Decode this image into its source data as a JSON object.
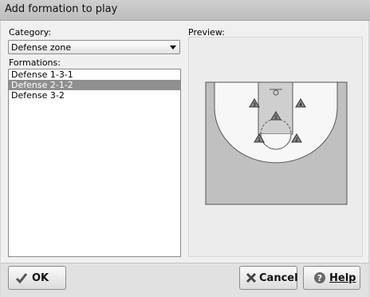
{
  "window": {
    "title": "Add formation to play"
  },
  "category": {
    "label": "Category:",
    "selected": "Defense zone"
  },
  "formations": {
    "label": "Formations:",
    "items": [
      "Defense 1-3-1",
      "Defense 2-1-2",
      "Defense 3-2"
    ],
    "selected_index": 1
  },
  "preview": {
    "label": "Preview:",
    "players": [
      "1",
      "2",
      "3",
      "4",
      "5"
    ],
    "court_color": "#c0c0c0",
    "key_color": "#cfcfcf",
    "player_color": "#8a8a8a"
  },
  "buttons": {
    "ok": "OK",
    "cancel": "Cancel",
    "help": "Help"
  },
  "icons": {
    "ok": "checkmark-icon",
    "cancel": "x-icon",
    "help": "help-icon"
  }
}
